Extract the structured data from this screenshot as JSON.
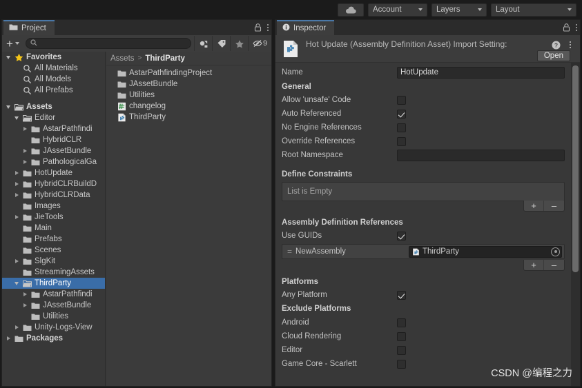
{
  "toolbar": {
    "cloud_icon": "cloud-icon",
    "account_label": "Account",
    "layers_label": "Layers",
    "layout_label": "Layout"
  },
  "project": {
    "tab_label": "Project",
    "lock_icon": "lock-icon",
    "menu_icon": "kebab-menu-icon",
    "add_label": "+",
    "search_value": "",
    "search_placeholder": "",
    "filter_buttons": [
      {
        "name": "filter-by-type-icon",
        "label": ""
      },
      {
        "name": "filter-by-label-icon",
        "label": ""
      },
      {
        "name": "filter-favorites-icon",
        "label": ""
      },
      {
        "name": "hidden-packages-icon",
        "label": "9"
      }
    ],
    "breadcrumb": {
      "root": "Assets",
      "separator": ">",
      "current": "ThirdParty"
    },
    "tree": [
      {
        "label": "Favorites",
        "indent": 0,
        "arrow": "down",
        "icon": "star-icon",
        "bold": true,
        "selected": false
      },
      {
        "label": "All Materials",
        "indent": 1,
        "arrow": "none",
        "icon": "search-icon",
        "bold": false,
        "selected": false
      },
      {
        "label": "All Models",
        "indent": 1,
        "arrow": "none",
        "icon": "search-icon",
        "bold": false,
        "selected": false
      },
      {
        "label": "All Prefabs",
        "indent": 1,
        "arrow": "none",
        "icon": "search-icon",
        "bold": false,
        "selected": false
      },
      {
        "label": "",
        "indent": 0,
        "arrow": "none",
        "icon": "spacer",
        "bold": false,
        "selected": false
      },
      {
        "label": "Assets",
        "indent": 0,
        "arrow": "down",
        "icon": "folder-open-icon",
        "bold": true,
        "selected": false
      },
      {
        "label": "Editor",
        "indent": 1,
        "arrow": "down",
        "icon": "folder-open-icon",
        "bold": false,
        "selected": false
      },
      {
        "label": "AstarPathfindi",
        "indent": 2,
        "arrow": "right",
        "icon": "folder-icon",
        "bold": false,
        "selected": false
      },
      {
        "label": "HybridCLR",
        "indent": 2,
        "arrow": "none",
        "icon": "folder-icon",
        "bold": false,
        "selected": false
      },
      {
        "label": "JAssetBundle",
        "indent": 2,
        "arrow": "right",
        "icon": "folder-icon",
        "bold": false,
        "selected": false
      },
      {
        "label": "PathologicalGa",
        "indent": 2,
        "arrow": "right",
        "icon": "folder-icon",
        "bold": false,
        "selected": false
      },
      {
        "label": "HotUpdate",
        "indent": 1,
        "arrow": "right",
        "icon": "folder-icon",
        "bold": false,
        "selected": false
      },
      {
        "label": "HybridCLRBuildD",
        "indent": 1,
        "arrow": "right",
        "icon": "folder-icon",
        "bold": false,
        "selected": false
      },
      {
        "label": "HybridCLRData",
        "indent": 1,
        "arrow": "right",
        "icon": "folder-icon",
        "bold": false,
        "selected": false
      },
      {
        "label": "Images",
        "indent": 1,
        "arrow": "none",
        "icon": "folder-icon",
        "bold": false,
        "selected": false
      },
      {
        "label": "JieTools",
        "indent": 1,
        "arrow": "right",
        "icon": "folder-icon",
        "bold": false,
        "selected": false
      },
      {
        "label": "Main",
        "indent": 1,
        "arrow": "none",
        "icon": "folder-icon",
        "bold": false,
        "selected": false
      },
      {
        "label": "Prefabs",
        "indent": 1,
        "arrow": "none",
        "icon": "folder-icon",
        "bold": false,
        "selected": false
      },
      {
        "label": "Scenes",
        "indent": 1,
        "arrow": "none",
        "icon": "folder-icon",
        "bold": false,
        "selected": false
      },
      {
        "label": "SlgKit",
        "indent": 1,
        "arrow": "right",
        "icon": "folder-icon",
        "bold": false,
        "selected": false
      },
      {
        "label": "StreamingAssets",
        "indent": 1,
        "arrow": "none",
        "icon": "folder-icon",
        "bold": false,
        "selected": false
      },
      {
        "label": "ThirdParty",
        "indent": 1,
        "arrow": "down",
        "icon": "folder-open-icon",
        "bold": false,
        "selected": true
      },
      {
        "label": "AstarPathfindi",
        "indent": 2,
        "arrow": "right",
        "icon": "folder-icon",
        "bold": false,
        "selected": false
      },
      {
        "label": "JAssetBundle",
        "indent": 2,
        "arrow": "right",
        "icon": "folder-icon",
        "bold": false,
        "selected": false
      },
      {
        "label": "Utilities",
        "indent": 2,
        "arrow": "none",
        "icon": "folder-icon",
        "bold": false,
        "selected": false
      },
      {
        "label": "Unity-Logs-View",
        "indent": 1,
        "arrow": "right",
        "icon": "folder-icon",
        "bold": false,
        "selected": false
      },
      {
        "label": "Packages",
        "indent": 0,
        "arrow": "right",
        "icon": "folder-icon",
        "bold": true,
        "selected": false
      }
    ],
    "contents": [
      {
        "label": "AstarPathfindingProject",
        "icon": "folder-icon"
      },
      {
        "label": "JAssetBundle",
        "icon": "folder-icon"
      },
      {
        "label": "Utilities",
        "icon": "folder-icon"
      },
      {
        "label": "changelog",
        "icon": "markdown-file-icon"
      },
      {
        "label": "ThirdParty",
        "icon": "asmdef-file-icon"
      }
    ]
  },
  "inspector": {
    "tab_label": "Inspector",
    "tab_icon": "info-icon",
    "lock_icon": "lock-icon",
    "menu_icon": "kebab-menu-icon",
    "asset_icon": "assembly-definition-icon",
    "title": "Hot Update (Assembly Definition Asset) Import Setting:",
    "help_icon": "help-icon",
    "kebab_icon": "kebab-menu-icon",
    "open_label": "Open",
    "name_label": "Name",
    "name_value": "HotUpdate",
    "general_header": "General",
    "general_fields": [
      {
        "label": "Allow 'unsafe' Code",
        "checked": false
      },
      {
        "label": "Auto Referenced",
        "checked": true
      },
      {
        "label": "No Engine References",
        "checked": false
      },
      {
        "label": "Override References",
        "checked": false
      }
    ],
    "root_namespace_label": "Root Namespace",
    "root_namespace_value": "",
    "define_constraints_header": "Define Constraints",
    "define_constraints_empty": "List is Empty",
    "asmdef_refs_header": "Assembly Definition References",
    "use_guids_label": "Use GUIDs",
    "use_guids_checked": true,
    "reference_rows": [
      {
        "drag_handle": "=",
        "name": "NewAssembly",
        "value": "ThirdParty",
        "value_icon": "asmdef-file-icon"
      }
    ],
    "add_label": "+",
    "remove_label": "–",
    "platforms_header": "Platforms",
    "any_platform_label": "Any Platform",
    "any_platform_checked": true,
    "exclude_platforms_header": "Exclude Platforms",
    "platform_rows": [
      {
        "label": "Android",
        "checked": false
      },
      {
        "label": "Cloud Rendering",
        "checked": false
      },
      {
        "label": "Editor",
        "checked": false
      },
      {
        "label": "Game Core - Scarlett",
        "checked": false
      }
    ]
  },
  "watermark": "CSDN @编程之力",
  "colors": {
    "selection_blue": "#3a6da8",
    "tab_accent": "#4a78a8",
    "panel_bg": "#383838"
  }
}
